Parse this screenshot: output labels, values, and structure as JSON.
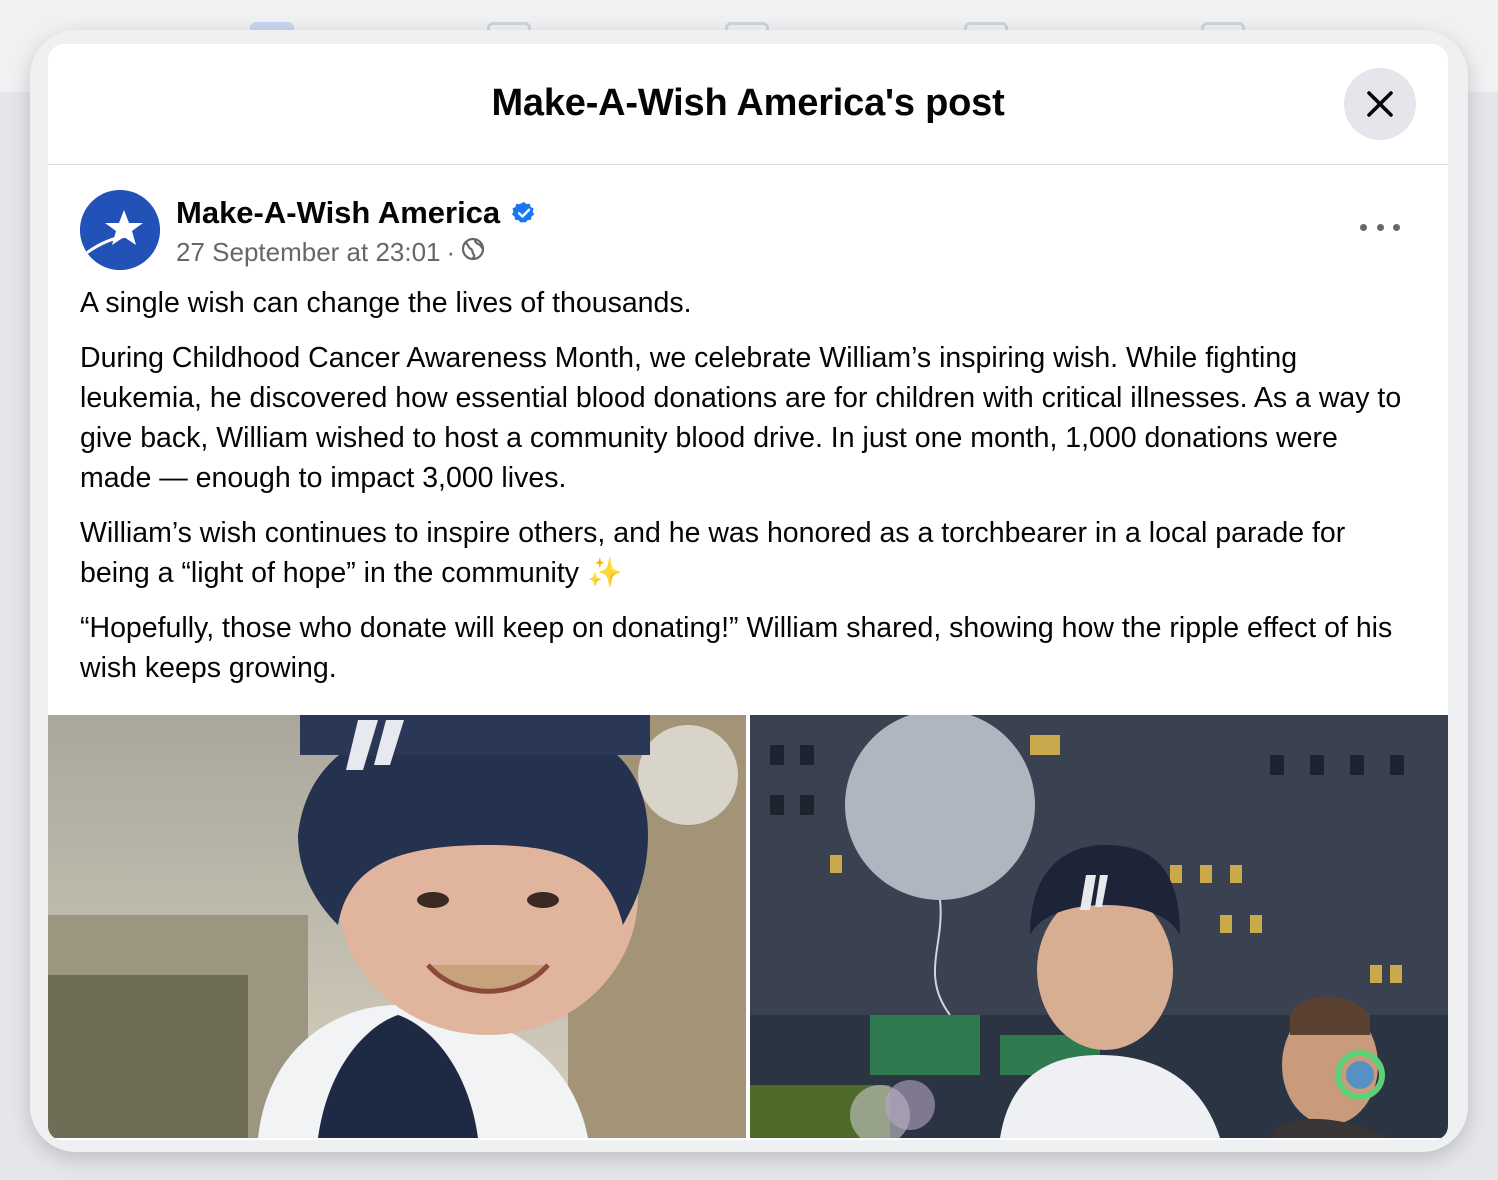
{
  "modal": {
    "title": "Make-A-Wish America's post",
    "close_icon": "close-icon"
  },
  "post": {
    "author": "Make-A-Wish America",
    "verified_icon": "verified-badge-icon",
    "timestamp": "27 September at 23:01",
    "separator": "·",
    "audience_icon": "globe-icon",
    "more_icon": "more-options-icon",
    "paragraphs": [
      "A single wish can change the lives of thousands.",
      "During Childhood Cancer Awareness Month, we celebrate William’s inspiring wish. While fighting leukemia, he discovered how essential blood donations are for children with critical illnesses. As a way to give back, William wished to host a community blood drive. In just one month, 1,000 donations were made — enough to impact 3,000 lives.",
      "William’s wish continues to inspire others, and he was honored as a torchbearer in a local parade for being a “light of hope” in the community ✨",
      "“Hopefully, those who donate will keep on donating!” William shared, showing how the ripple effect of his wish keeps growing."
    ]
  },
  "colors": {
    "brand_blue": "#2251b8",
    "verified_blue": "#1877f2",
    "text_primary": "#050505",
    "text_secondary": "#65676b"
  }
}
